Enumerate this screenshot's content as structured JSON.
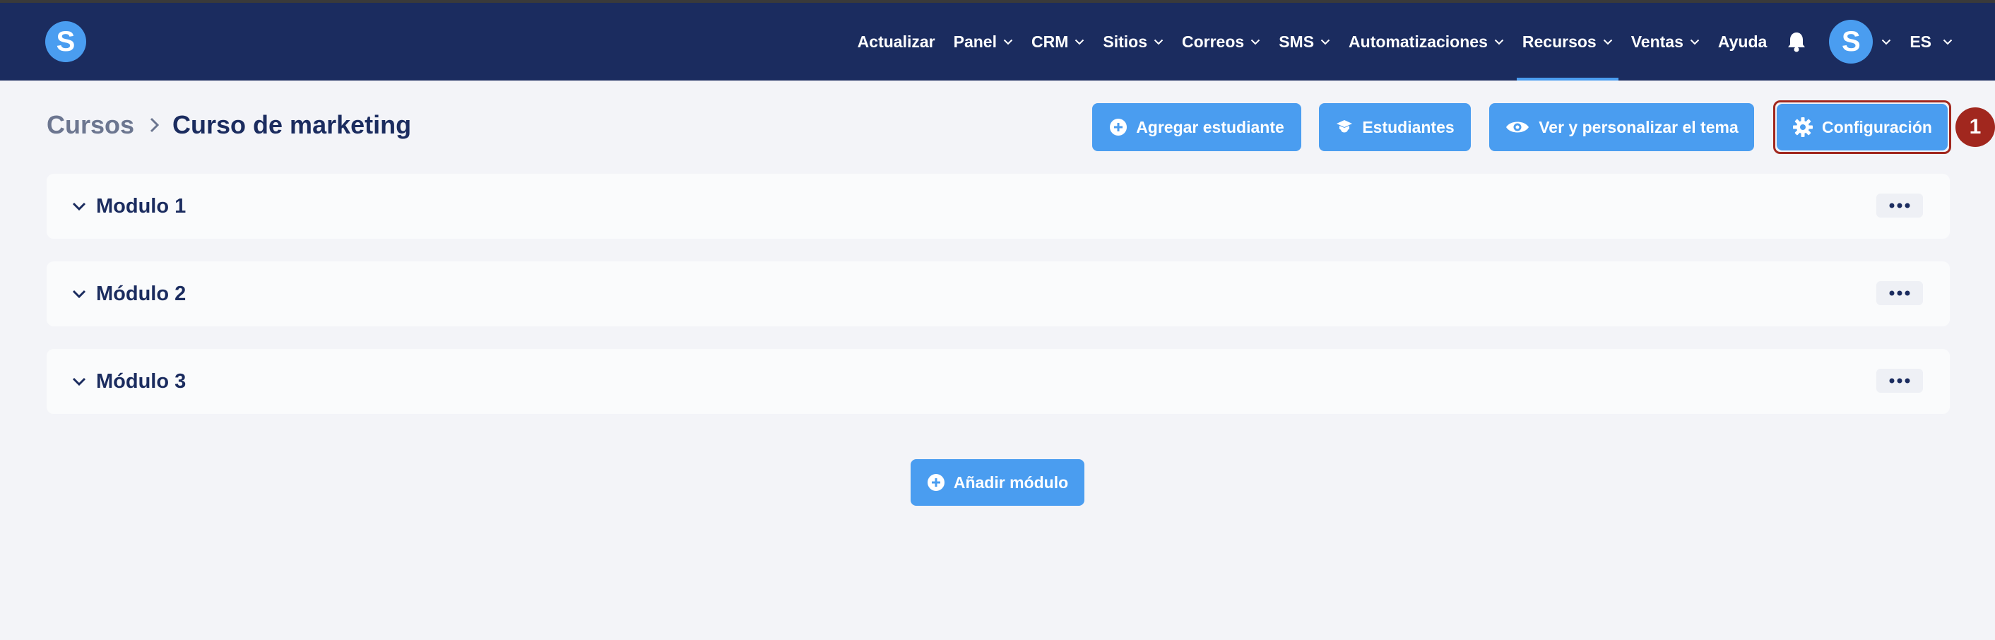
{
  "app": {
    "logo_letter": "S",
    "brand_color": "#4a9df0",
    "nav_color": "#1b2c5f"
  },
  "nav": {
    "items": [
      {
        "label": "Actualizar",
        "dropdown": false
      },
      {
        "label": "Panel",
        "dropdown": true
      },
      {
        "label": "CRM",
        "dropdown": true
      },
      {
        "label": "Sitios",
        "dropdown": true
      },
      {
        "label": "Correos",
        "dropdown": true
      },
      {
        "label": "SMS",
        "dropdown": true
      },
      {
        "label": "Automatizaciones",
        "dropdown": true
      },
      {
        "label": "Recursos",
        "dropdown": true,
        "active": true
      },
      {
        "label": "Ventas",
        "dropdown": true
      },
      {
        "label": "Ayuda",
        "dropdown": false
      }
    ],
    "avatar_letter": "S",
    "language": "ES"
  },
  "breadcrumb": {
    "root": "Cursos",
    "current": "Curso de marketing"
  },
  "actions": {
    "add_student": "Agregar estudiante",
    "students": "Estudiantes",
    "view_theme": "Ver y personalizar el tema",
    "settings": "Configuración"
  },
  "highlight": {
    "step": "1",
    "color": "#a1271e"
  },
  "modules": [
    {
      "title": "Modulo 1"
    },
    {
      "title": "Módulo 2"
    },
    {
      "title": "Módulo 3"
    }
  ],
  "add_module": "Añadir módulo"
}
